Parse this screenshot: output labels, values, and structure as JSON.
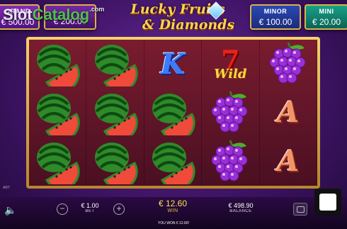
{
  "watermark": {
    "a": "Slot",
    "b": "Catalog",
    "domain": ".com"
  },
  "jackpots": {
    "grand": {
      "label": "GRAND",
      "value": "€ 500.00"
    },
    "major": {
      "value": "€ 200.00"
    },
    "minor": {
      "label": "MINOR",
      "value": "€ 100.00"
    },
    "mini": {
      "label": "MINI",
      "value": "€ 20.00"
    }
  },
  "logo": {
    "line1": "Lucky Fruits",
    "line2": "& Diamonds"
  },
  "symbols": {
    "king": "K",
    "ace": "A",
    "seven": "7",
    "wild": "Wild"
  },
  "grid": [
    [
      "watermelon",
      "watermelon",
      "king",
      "wild",
      "grapes"
    ],
    [
      "watermelon",
      "watermelon",
      "watermelon",
      "grapes",
      "ace"
    ],
    [
      "watermelon",
      "watermelon",
      "watermelon",
      "grapes",
      "ace"
    ]
  ],
  "bottom": {
    "bet_value": "€ 1.00",
    "bet_label": "BET",
    "win_value": "€ 12.60",
    "win_label": "WIN",
    "balance_value": "€ 498.90",
    "balance_label": "BALANCE",
    "message": "YOU WON € 12.60!",
    "minus": "−",
    "plus": "+",
    "speaker": "🔈",
    "brand": "ART"
  },
  "colors": {
    "frame": "#e0b24a",
    "reel_bg": "#6a1a2c",
    "win": "#ffe04a"
  }
}
